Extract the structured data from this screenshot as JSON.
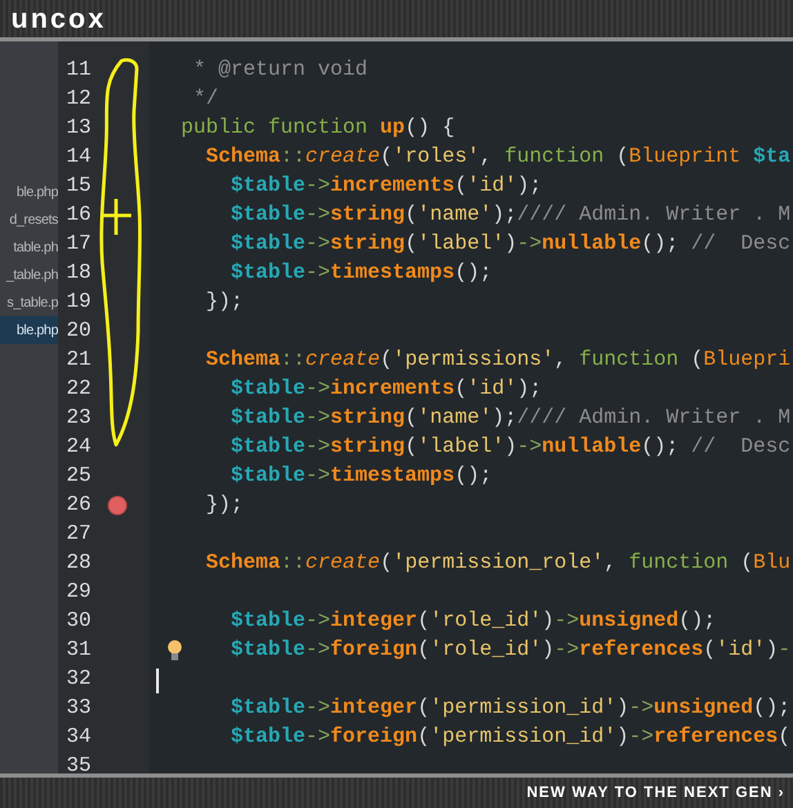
{
  "header": {
    "logo": "uncox"
  },
  "sidebar": {
    "items": [
      {
        "label": "ble.php",
        "selected": false
      },
      {
        "label": "d_resets",
        "selected": false
      },
      {
        "label": "table.ph",
        "selected": false
      },
      {
        "label": "_table.ph",
        "selected": false
      },
      {
        "label": "s_table.p",
        "selected": false
      },
      {
        "label": "ble.php",
        "selected": true
      }
    ]
  },
  "editor": {
    "lines": [
      {
        "number": "11",
        "tokens": [
          {
            "kind": "comment",
            "text": "   * @return void"
          }
        ]
      },
      {
        "number": "12",
        "tokens": [
          {
            "kind": "comment",
            "text": "   */"
          }
        ]
      },
      {
        "number": "13",
        "tokens": [
          {
            "kind": "keyword",
            "text": "  public function "
          },
          {
            "kind": "method",
            "text": "up"
          },
          {
            "kind": "punct",
            "text": "() {"
          }
        ]
      },
      {
        "number": "14",
        "tokens": [
          {
            "kind": "class",
            "text": "    Schema"
          },
          {
            "kind": "op",
            "text": "::"
          },
          {
            "kind": "static",
            "text": "create"
          },
          {
            "kind": "punct",
            "text": "("
          },
          {
            "kind": "string",
            "text": "'roles'"
          },
          {
            "kind": "punct",
            "text": ", "
          },
          {
            "kind": "keyword",
            "text": "function"
          },
          {
            "kind": "punct",
            "text": " ("
          },
          {
            "kind": "type",
            "text": "Blueprint "
          },
          {
            "kind": "var",
            "text": "$ta"
          }
        ]
      },
      {
        "number": "15",
        "tokens": [
          {
            "kind": "var",
            "text": "      $table"
          },
          {
            "kind": "op",
            "text": "->"
          },
          {
            "kind": "method",
            "text": "increments"
          },
          {
            "kind": "punct",
            "text": "("
          },
          {
            "kind": "string",
            "text": "'id'"
          },
          {
            "kind": "punct",
            "text": ");"
          }
        ]
      },
      {
        "number": "16",
        "tokens": [
          {
            "kind": "var",
            "text": "      $table"
          },
          {
            "kind": "op",
            "text": "->"
          },
          {
            "kind": "method",
            "text": "string"
          },
          {
            "kind": "punct",
            "text": "("
          },
          {
            "kind": "string",
            "text": "'name'"
          },
          {
            "kind": "punct",
            "text": ");"
          },
          {
            "kind": "comment",
            "text": "//// Admin. Writer . M"
          }
        ]
      },
      {
        "number": "17",
        "tokens": [
          {
            "kind": "var",
            "text": "      $table"
          },
          {
            "kind": "op",
            "text": "->"
          },
          {
            "kind": "method",
            "text": "string"
          },
          {
            "kind": "punct",
            "text": "("
          },
          {
            "kind": "string",
            "text": "'label'"
          },
          {
            "kind": "punct",
            "text": ")"
          },
          {
            "kind": "op",
            "text": "->"
          },
          {
            "kind": "method",
            "text": "nullable"
          },
          {
            "kind": "punct",
            "text": "(); "
          },
          {
            "kind": "comment",
            "text": "//  Desc"
          }
        ]
      },
      {
        "number": "18",
        "tokens": [
          {
            "kind": "var",
            "text": "      $table"
          },
          {
            "kind": "op",
            "text": "->"
          },
          {
            "kind": "method",
            "text": "timestamps"
          },
          {
            "kind": "punct",
            "text": "();"
          }
        ]
      },
      {
        "number": "19",
        "tokens": [
          {
            "kind": "punct",
            "text": "    });"
          }
        ]
      },
      {
        "number": "20",
        "kind": "plain"
      },
      {
        "number": "21",
        "tokens": [
          {
            "kind": "class",
            "text": "    Schema"
          },
          {
            "kind": "op",
            "text": "::"
          },
          {
            "kind": "static",
            "text": "create"
          },
          {
            "kind": "punct",
            "text": "("
          },
          {
            "kind": "string",
            "text": "'permissions'"
          },
          {
            "kind": "punct",
            "text": ", "
          },
          {
            "kind": "keyword",
            "text": "function"
          },
          {
            "kind": "punct",
            "text": " ("
          },
          {
            "kind": "type",
            "text": "Bluepri"
          }
        ]
      },
      {
        "number": "22",
        "tokens": [
          {
            "kind": "var",
            "text": "      $table"
          },
          {
            "kind": "op",
            "text": "->"
          },
          {
            "kind": "method",
            "text": "increments"
          },
          {
            "kind": "punct",
            "text": "("
          },
          {
            "kind": "string",
            "text": "'id'"
          },
          {
            "kind": "punct",
            "text": ");"
          }
        ]
      },
      {
        "number": "23",
        "tokens": [
          {
            "kind": "var",
            "text": "      $table"
          },
          {
            "kind": "op",
            "text": "->"
          },
          {
            "kind": "method",
            "text": "string"
          },
          {
            "kind": "punct",
            "text": "("
          },
          {
            "kind": "string",
            "text": "'name'"
          },
          {
            "kind": "punct",
            "text": ");"
          },
          {
            "kind": "comment",
            "text": "//// Admin. Writer . M"
          }
        ]
      },
      {
        "number": "24",
        "tokens": [
          {
            "kind": "var",
            "text": "      $table"
          },
          {
            "kind": "op",
            "text": "->"
          },
          {
            "kind": "method",
            "text": "string"
          },
          {
            "kind": "punct",
            "text": "("
          },
          {
            "kind": "string",
            "text": "'label'"
          },
          {
            "kind": "punct",
            "text": ")"
          },
          {
            "kind": "op",
            "text": "->"
          },
          {
            "kind": "method",
            "text": "nullable"
          },
          {
            "kind": "punct",
            "text": "(); "
          },
          {
            "kind": "comment",
            "text": "//  Desc"
          }
        ]
      },
      {
        "number": "25",
        "tokens": [
          {
            "kind": "var",
            "text": "      $table"
          },
          {
            "kind": "op",
            "text": "->"
          },
          {
            "kind": "method",
            "text": "timestamps"
          },
          {
            "kind": "punct",
            "text": "();"
          }
        ]
      },
      {
        "number": "26",
        "kind": "breakpoint",
        "tokens": [
          {
            "kind": "punct",
            "text": "    });"
          }
        ]
      },
      {
        "number": "27",
        "kind": "plain"
      },
      {
        "number": "28",
        "tokens": [
          {
            "kind": "class",
            "text": "    Schema"
          },
          {
            "kind": "op",
            "text": "::"
          },
          {
            "kind": "static",
            "text": "create"
          },
          {
            "kind": "punct",
            "text": "("
          },
          {
            "kind": "string",
            "text": "'permission_role'"
          },
          {
            "kind": "punct",
            "text": ", "
          },
          {
            "kind": "keyword",
            "text": "function"
          },
          {
            "kind": "punct",
            "text": " ("
          },
          {
            "kind": "type",
            "text": "Blu"
          }
        ]
      },
      {
        "number": "29",
        "kind": "plain"
      },
      {
        "number": "30",
        "tokens": [
          {
            "kind": "var",
            "text": "      $table"
          },
          {
            "kind": "op",
            "text": "->"
          },
          {
            "kind": "method",
            "text": "integer"
          },
          {
            "kind": "punct",
            "text": "("
          },
          {
            "kind": "string",
            "text": "'role_id'"
          },
          {
            "kind": "punct",
            "text": ")"
          },
          {
            "kind": "op",
            "text": "->"
          },
          {
            "kind": "method",
            "text": "unsigned"
          },
          {
            "kind": "punct",
            "text": "();"
          }
        ]
      },
      {
        "number": "31",
        "kind": "lightbulb",
        "tokens": [
          {
            "kind": "var",
            "text": "      $table"
          },
          {
            "kind": "op",
            "text": "->"
          },
          {
            "kind": "method",
            "text": "foreign"
          },
          {
            "kind": "punct",
            "text": "("
          },
          {
            "kind": "string",
            "text": "'role_id'"
          },
          {
            "kind": "punct",
            "text": ")"
          },
          {
            "kind": "op",
            "text": "->"
          },
          {
            "kind": "method",
            "text": "references"
          },
          {
            "kind": "punct",
            "text": "("
          },
          {
            "kind": "string",
            "text": "'id'"
          },
          {
            "kind": "punct",
            "text": ")"
          },
          {
            "kind": "op",
            "text": "-"
          }
        ]
      },
      {
        "number": "32",
        "kind": "cursor"
      },
      {
        "number": "33",
        "tokens": [
          {
            "kind": "var",
            "text": "      $table"
          },
          {
            "kind": "op",
            "text": "->"
          },
          {
            "kind": "method",
            "text": "integer"
          },
          {
            "kind": "punct",
            "text": "("
          },
          {
            "kind": "string",
            "text": "'permission_id'"
          },
          {
            "kind": "punct",
            "text": ")"
          },
          {
            "kind": "op",
            "text": "->"
          },
          {
            "kind": "method",
            "text": "unsigned"
          },
          {
            "kind": "punct",
            "text": "();"
          }
        ]
      },
      {
        "number": "34",
        "tokens": [
          {
            "kind": "var",
            "text": "      $table"
          },
          {
            "kind": "op",
            "text": "->"
          },
          {
            "kind": "method",
            "text": "foreign"
          },
          {
            "kind": "punct",
            "text": "("
          },
          {
            "kind": "string",
            "text": "'permission_id'"
          },
          {
            "kind": "punct",
            "text": ")"
          },
          {
            "kind": "op",
            "text": "->"
          },
          {
            "kind": "method",
            "text": "references"
          },
          {
            "kind": "punct",
            "text": "("
          }
        ]
      },
      {
        "number": "35",
        "kind": "plain"
      }
    ]
  },
  "footer": {
    "tagline": "NEW WAY TO THE NEXT GEN ›"
  }
}
